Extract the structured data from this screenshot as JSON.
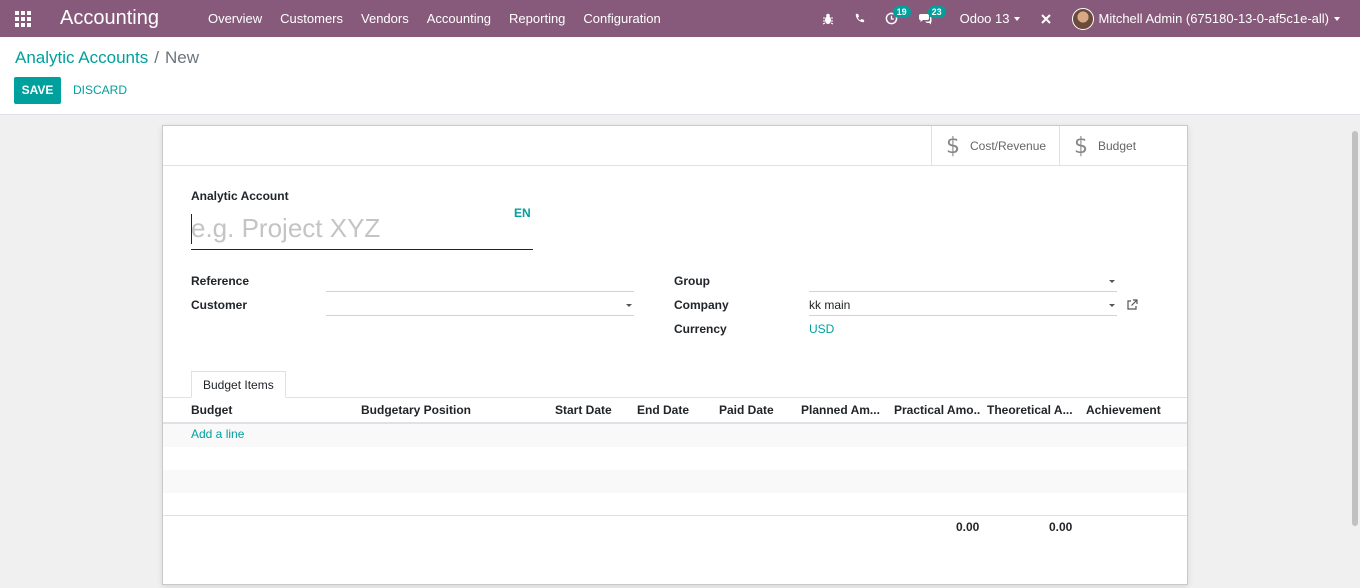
{
  "navbar": {
    "app_title": "Accounting",
    "menu": [
      "Overview",
      "Customers",
      "Vendors",
      "Accounting",
      "Reporting",
      "Configuration"
    ],
    "activity_count": "19",
    "messages_count": "23",
    "database": "Odoo 13",
    "user": "Mitchell Admin (675180-13-0-af5c1e-all)",
    "accent_color": "#875a7b"
  },
  "breadcrumb": {
    "parent": "Analytic Accounts",
    "current": "New"
  },
  "buttons": {
    "save": "SAVE",
    "discard": "DISCARD"
  },
  "smart_buttons": {
    "cost_revenue": "Cost/Revenue",
    "budget": "Budget",
    "icon": "$"
  },
  "form": {
    "title_label": "Analytic Account",
    "title_placeholder": "e.g. Project XYZ",
    "lang": "EN",
    "labels": {
      "reference": "Reference",
      "customer": "Customer",
      "group": "Group",
      "company": "Company",
      "currency": "Currency"
    },
    "values": {
      "reference": "",
      "customer": "",
      "group": "",
      "company": "kk main",
      "currency": "USD"
    }
  },
  "notebook": {
    "tab": "Budget Items",
    "columns": [
      "Budget",
      "Budgetary Position",
      "Start Date",
      "End Date",
      "Paid Date",
      "Planned Am...",
      "Practical Amo...",
      "Theoretical A...",
      "Achievement"
    ],
    "add_line": "Add a line",
    "totals": {
      "practical": "0.00",
      "theoretical": "0.00"
    }
  }
}
